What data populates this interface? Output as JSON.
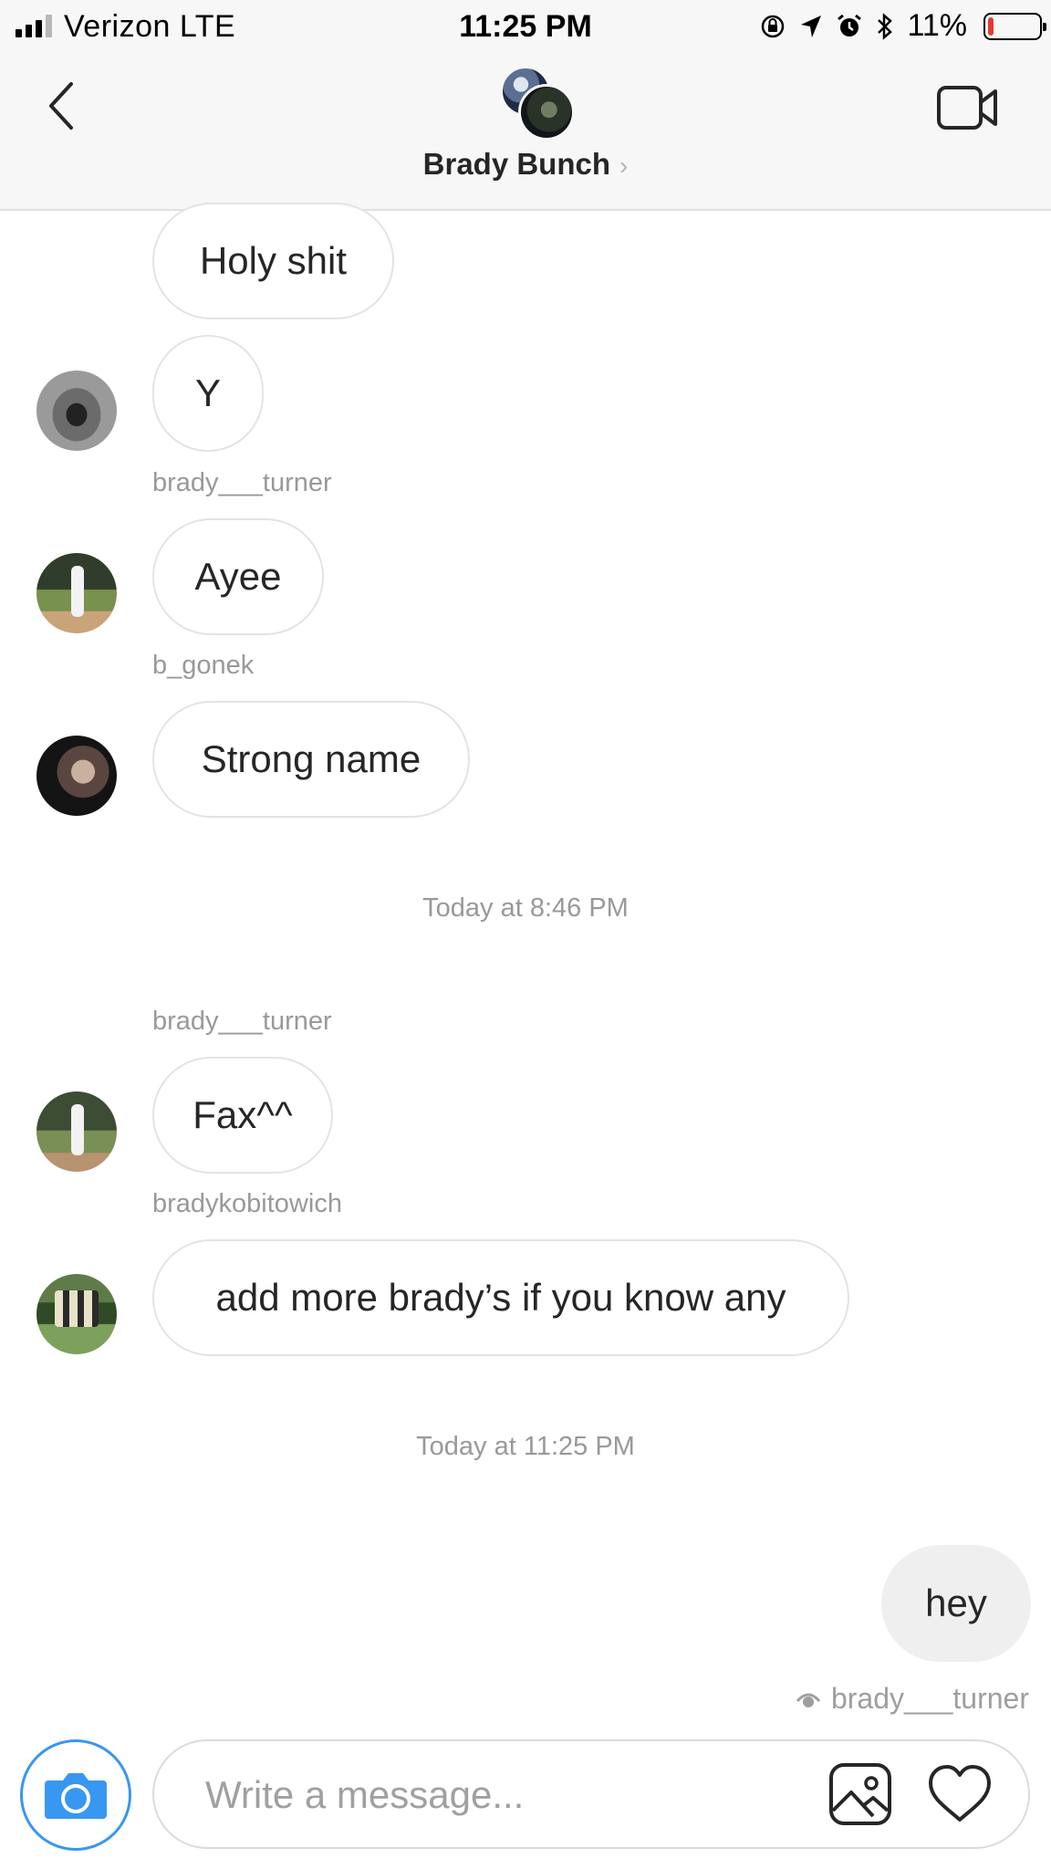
{
  "status_bar": {
    "carrier": "Verizon   LTE",
    "time": "11:25 PM",
    "battery": "11%",
    "battery_level": 0.11,
    "icons": [
      "signal-icon",
      "rotation-lock-icon",
      "location-icon",
      "alarm-icon",
      "bluetooth-icon",
      "battery-icon"
    ]
  },
  "header": {
    "title": "Brady Bunch",
    "chevron": "›",
    "back_icon": "back-chevron-icon",
    "video_icon": "video-call-icon"
  },
  "messages": [
    {
      "id": "m1",
      "text": "Holy shit"
    },
    {
      "id": "m2",
      "text": "Y"
    },
    {
      "id": "m3",
      "sender": "brady___turner",
      "text": "Ayee"
    },
    {
      "id": "m4",
      "sender": "b_gonek",
      "text": "Strong name"
    },
    {
      "id": "t1",
      "timestamp": "Today at 8:46 PM"
    },
    {
      "id": "m5",
      "sender": "brady___turner",
      "text": "Fax^^"
    },
    {
      "id": "m6",
      "sender": "bradykobitowich",
      "text": "add more brady’s if you know any"
    },
    {
      "id": "t2",
      "timestamp": "Today at 11:25 PM"
    },
    {
      "id": "m7",
      "text": "hey",
      "mine": true
    }
  ],
  "seen_by": "brady___turner",
  "composer": {
    "placeholder": "Write a message...",
    "value": "",
    "camera_icon": "camera-icon",
    "gallery_icon": "gallery-icon",
    "like_icon": "heart-icon"
  },
  "colors": {
    "accent": "#3897f0",
    "battery_low": "#e53935",
    "bubble_border": "#e3e3e3",
    "my_bubble": "#efefef",
    "meta_text": "#999999"
  }
}
